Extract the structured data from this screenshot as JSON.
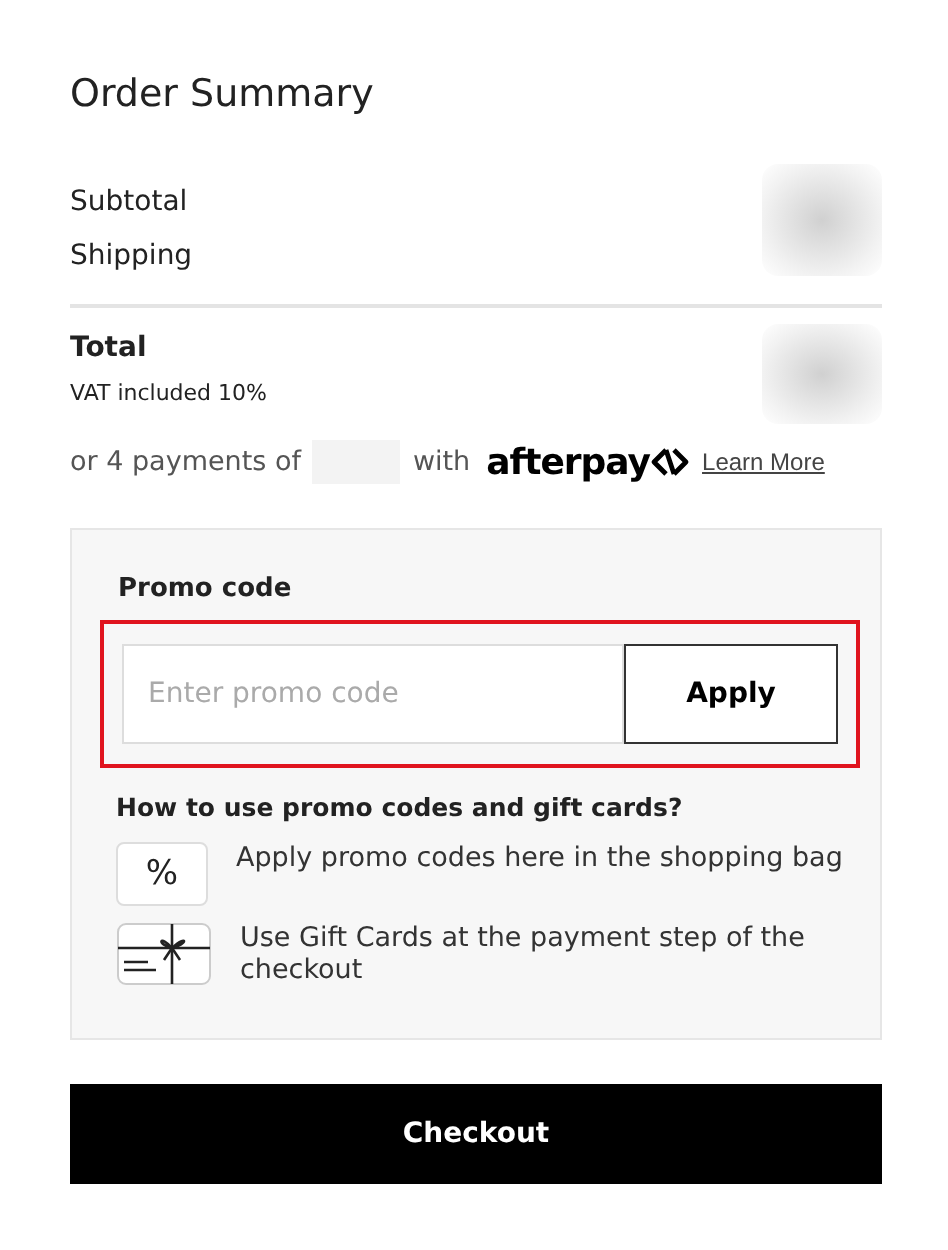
{
  "title": "Order Summary",
  "lines": [
    {
      "label": "Subtotal"
    },
    {
      "label": "Shipping"
    }
  ],
  "total": {
    "label": "Total",
    "note": "VAT included 10%"
  },
  "installments": {
    "prefix": "or 4 payments of",
    "middle": "with",
    "brand": "afterpay",
    "link": "Learn More"
  },
  "promo": {
    "label": "Promo code",
    "placeholder": "Enter promo code",
    "button": "Apply",
    "highlighted": true
  },
  "help": {
    "heading": "How to use promo codes and gift cards?",
    "items": [
      {
        "kind": "percent",
        "icon_text": "%",
        "text": "Apply promo codes here in the shopping bag"
      },
      {
        "kind": "giftcard",
        "text": "Use Gift Cards at the payment step of the checkout"
      }
    ]
  },
  "checkout_button": "Checkout"
}
